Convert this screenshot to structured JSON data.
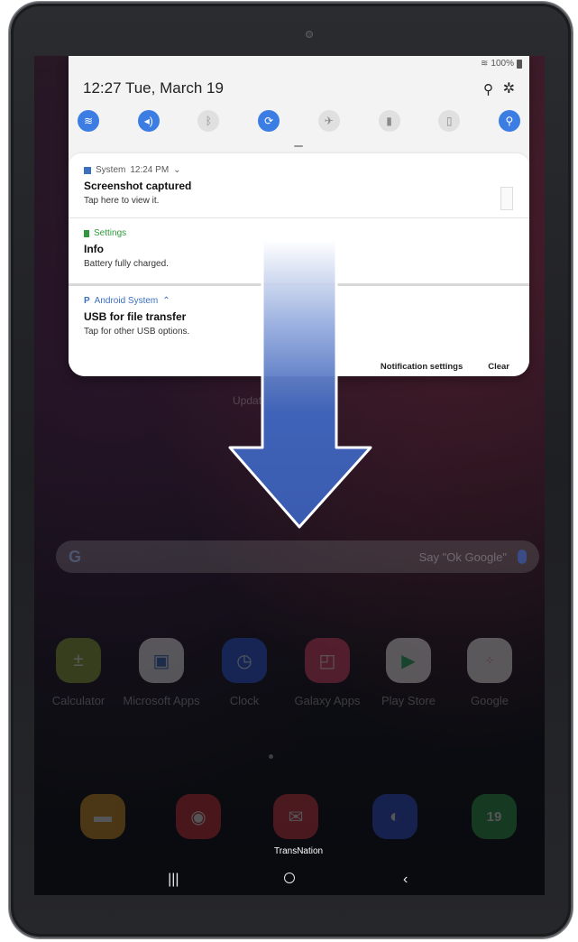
{
  "status_bar": {
    "battery": "100%"
  },
  "panel": {
    "time": "12:27",
    "date": "Tue, March 19",
    "quick_settings": [
      {
        "icon": "wifi-icon",
        "state": "on"
      },
      {
        "icon": "sound-icon",
        "state": "on"
      },
      {
        "icon": "bluetooth-icon",
        "state": "off"
      },
      {
        "icon": "auto-rotate-icon",
        "state": "on"
      },
      {
        "icon": "airplane-mode-icon",
        "state": "off"
      },
      {
        "icon": "power-saving-icon",
        "state": "off"
      },
      {
        "icon": "blue-light-filter-icon",
        "state": "off"
      },
      {
        "icon": "location-icon",
        "state": "on"
      }
    ],
    "notifications": [
      {
        "app": "System",
        "time": "12:24 PM",
        "title": "Screenshot captured",
        "body": "Tap here to view it.",
        "app_color": "#3b6fbf"
      },
      {
        "app": "Settings",
        "app_only": true,
        "title": "Info",
        "body": "Battery fully charged.",
        "app_color": "#2f9a3c"
      },
      {
        "app": "Android System",
        "title": "USB for file transfer",
        "body": "Tap for other USB options.",
        "app_color": "#3b6fbf"
      }
    ],
    "footer": {
      "settings_label": "Notification settings",
      "clear_label": "Clear"
    }
  },
  "home": {
    "update_text": "Updat",
    "search_hint": "Say \"Ok Google\"",
    "apps": [
      {
        "label": "Calculator",
        "icon": "calculator-icon",
        "color": "#8aa33a"
      },
      {
        "label": "Microsoft Apps",
        "icon": "microsoft-apps-icon",
        "color": "#e8e8e8"
      },
      {
        "label": "Clock",
        "icon": "clock-icon",
        "color": "#2d5bd8"
      },
      {
        "label": "Galaxy Apps",
        "icon": "galaxy-apps-icon",
        "color": "#d8466a"
      },
      {
        "label": "Play Store",
        "icon": "play-store-icon",
        "color": "#f0f0f0"
      },
      {
        "label": "Google",
        "icon": "google-folder-icon",
        "color": "#eeeeee"
      }
    ],
    "dock": [
      {
        "icon": "my-files-icon",
        "color": "#e09a2a"
      },
      {
        "icon": "camera-icon",
        "color": "#d8353f"
      },
      {
        "icon": "email-icon",
        "color": "#e0404a"
      },
      {
        "icon": "internet-icon",
        "color": "#3a5be0"
      },
      {
        "icon": "calendar-icon",
        "color": "#3aa653"
      }
    ],
    "dock_label": "TransNation",
    "calendar_day": "19"
  },
  "arrow": {
    "color": "#3f63b8"
  }
}
